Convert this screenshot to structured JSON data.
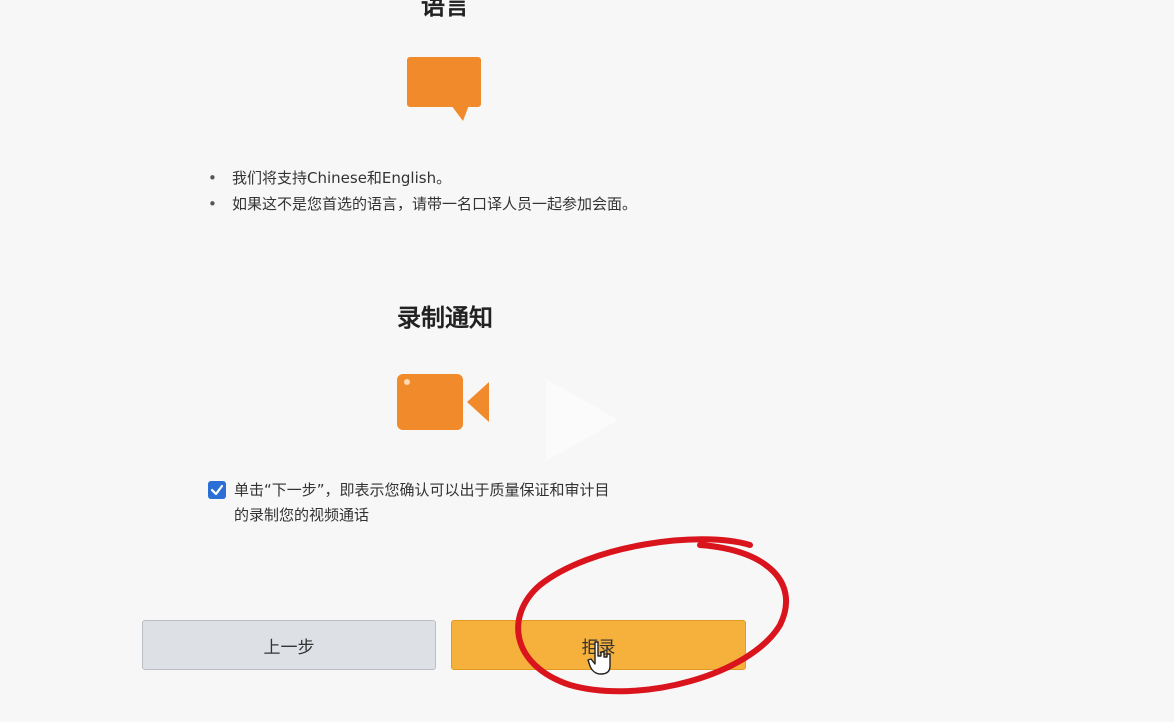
{
  "sections": {
    "language": {
      "title": "语言",
      "icon": "speech-bubble-icon",
      "bullets": [
        "我们将支持Chinese和English。",
        "如果这不是您首选的语言，请带一名口译人员一起参加会面。"
      ]
    },
    "recording": {
      "title": "录制通知",
      "icon": "video-camera-icon",
      "consent_checked": true,
      "consent_text": "单击“下一步”，即表示您确认可以出于质量保证和审计目的录制您的视频通话"
    }
  },
  "buttons": {
    "prev_label": "上一步",
    "next_label": "拒录"
  },
  "colors": {
    "accent_orange": "#f18a2b",
    "next_button": "#f5b13c",
    "prev_button": "#dde1e6",
    "checkbox": "#2b6fd6",
    "annotation_red": "#d9141c"
  }
}
